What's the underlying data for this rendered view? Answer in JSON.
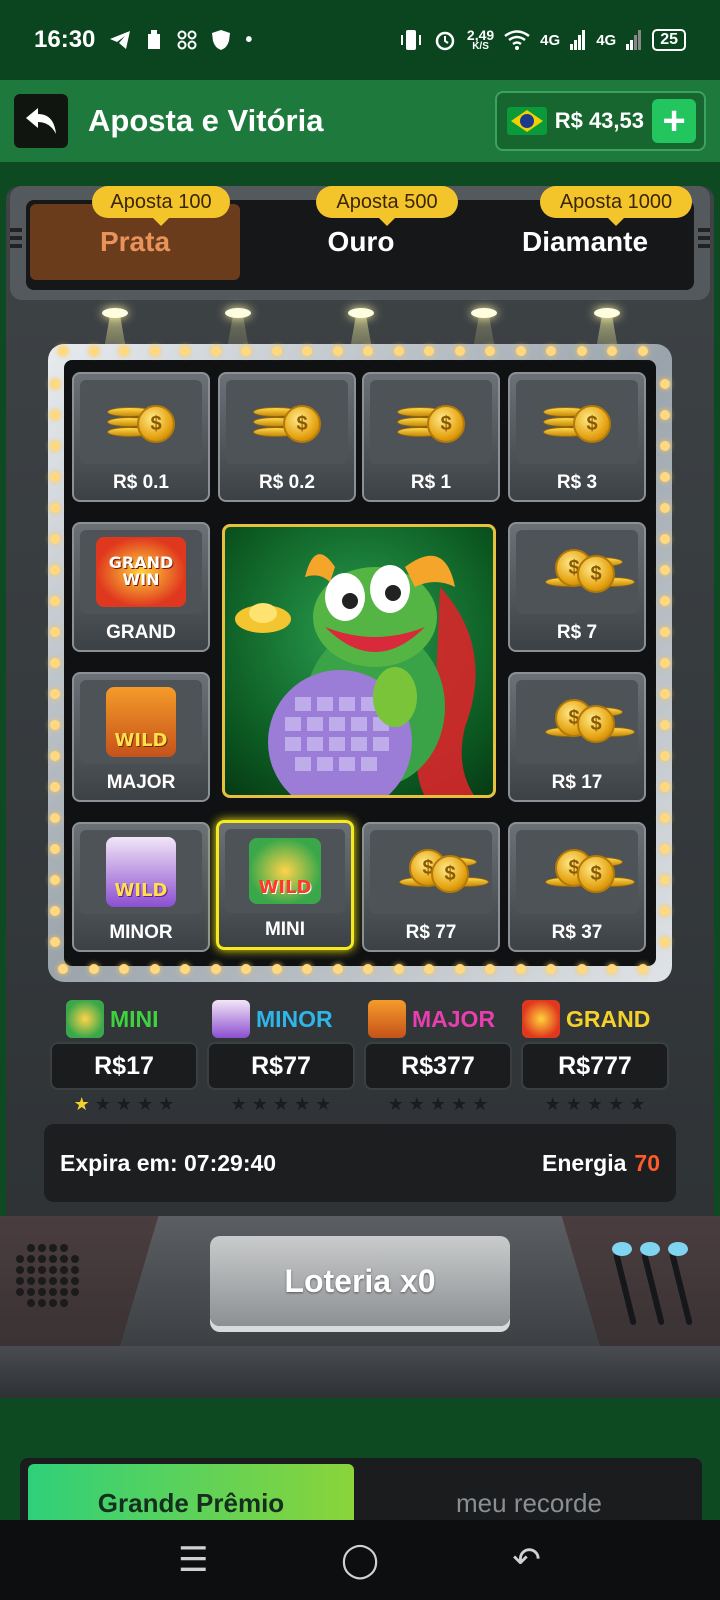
{
  "status_bar": {
    "time": "16:30",
    "net_speed_value": "2,49",
    "net_speed_unit": "K/S",
    "network_1": "4G",
    "network_2": "4G",
    "battery": "25"
  },
  "header": {
    "title": "Aposta e Vitória",
    "balance": "R$ 43,53",
    "add_label": "+"
  },
  "tiers": [
    {
      "badge": "Aposta 100",
      "label": "Prata",
      "active": true
    },
    {
      "badge": "Aposta 500",
      "label": "Ouro",
      "active": false
    },
    {
      "badge": "Aposta 1000",
      "label": "Diamante",
      "active": false
    }
  ],
  "board": {
    "tiles": [
      {
        "label": "R$ 0.1",
        "type": "coins"
      },
      {
        "label": "R$ 0.2",
        "type": "coins"
      },
      {
        "label": "R$ 1",
        "type": "coins"
      },
      {
        "label": "R$ 3",
        "type": "coins"
      },
      {
        "label": "GRAND",
        "type": "grand"
      },
      {
        "label": "R$ 7",
        "type": "coins"
      },
      {
        "label": "MAJOR",
        "type": "major"
      },
      {
        "label": "R$ 17",
        "type": "coins"
      },
      {
        "label": "MINOR",
        "type": "minor"
      },
      {
        "label": "MINI",
        "type": "mini",
        "highlighted": true
      },
      {
        "label": "R$ 77",
        "type": "coins"
      },
      {
        "label": "R$ 37",
        "type": "coins"
      }
    ],
    "art": {
      "grand_line1": "GRAND",
      "grand_line2": "WIN",
      "wild": "WILD",
      "coin_symbol": "$"
    }
  },
  "jackpots": [
    {
      "name": "MINI",
      "value": "R$17",
      "stars_filled": 1,
      "stars_total": 5,
      "color": "#3fd23f"
    },
    {
      "name": "MINOR",
      "value": "R$77",
      "stars_filled": 0,
      "stars_total": 5,
      "color": "#2fb6e8"
    },
    {
      "name": "MAJOR",
      "value": "R$377",
      "stars_filled": 0,
      "stars_total": 5,
      "color": "#e83fae"
    },
    {
      "name": "GRAND",
      "value": "R$777",
      "stars_filled": 0,
      "stars_total": 5,
      "color": "#f5d22b"
    }
  ],
  "timer_panel": {
    "expire_label": "Expira em: 07:29:40",
    "energy_label": "Energia",
    "energy_value": "70"
  },
  "lottery_button": "Loteria x0",
  "bottom_tabs": {
    "active": "Grande Prêmio",
    "inactive": "meu recorde"
  },
  "navbar": {
    "menu": "☰",
    "home": "◯",
    "back": "↶"
  }
}
